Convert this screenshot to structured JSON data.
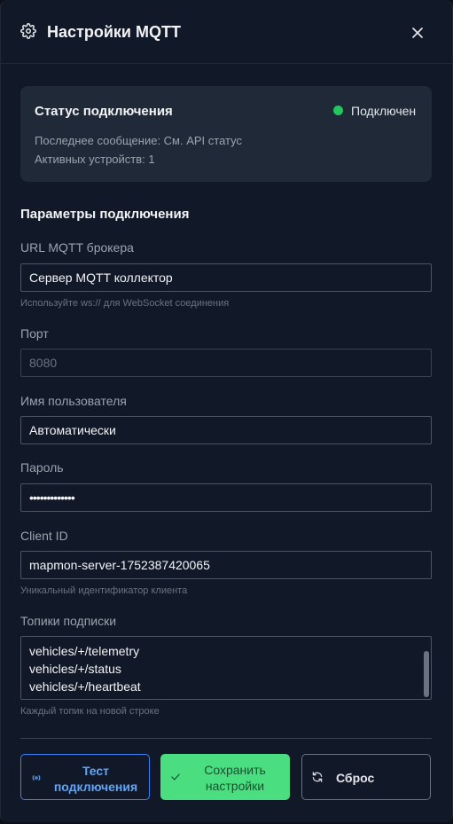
{
  "header": {
    "title": "Настройки MQTT",
    "gear_icon": "gear-icon",
    "close_icon": "close-icon"
  },
  "status": {
    "title": "Статус подключения",
    "state": "Подключен",
    "state_color": "#22c55e",
    "last_message": "Последнее сообщение: См. API статус",
    "active_devices": "Активных устройств: 1"
  },
  "params": {
    "title": "Параметры подключения",
    "broker_url": {
      "label": "URL MQTT брокера",
      "value": "Сервер MQTT коллектор",
      "hint": "Используйте ws:// для WebSocket соединения"
    },
    "port": {
      "label": "Порт",
      "placeholder": "8080"
    },
    "username": {
      "label": "Имя пользователя",
      "value": "Автоматически"
    },
    "password": {
      "label": "Пароль",
      "value": "•••••••••••••"
    },
    "client_id": {
      "label": "Client ID",
      "value": "mapmon-server-1752387420065",
      "hint": "Уникальный идентификатор клиента"
    },
    "topics": {
      "label": "Топики подписки",
      "lines": [
        "vehicles/+/telemetry",
        "vehicles/+/status",
        "vehicles/+/heartbeat"
      ],
      "hint": "Каждый топик на новой строке"
    }
  },
  "buttons": {
    "test": {
      "line1": "Тест",
      "line2": "подключения",
      "icon": "signal-icon"
    },
    "save": {
      "line1": "Сохранить",
      "line2": "настройки",
      "icon": "check-icon"
    },
    "reset": {
      "label": "Сброс",
      "icon": "refresh-icon"
    }
  },
  "colors": {
    "accent": "#3b82f6",
    "save": "#4ade80",
    "background": "#111827",
    "card": "#1f2937"
  }
}
